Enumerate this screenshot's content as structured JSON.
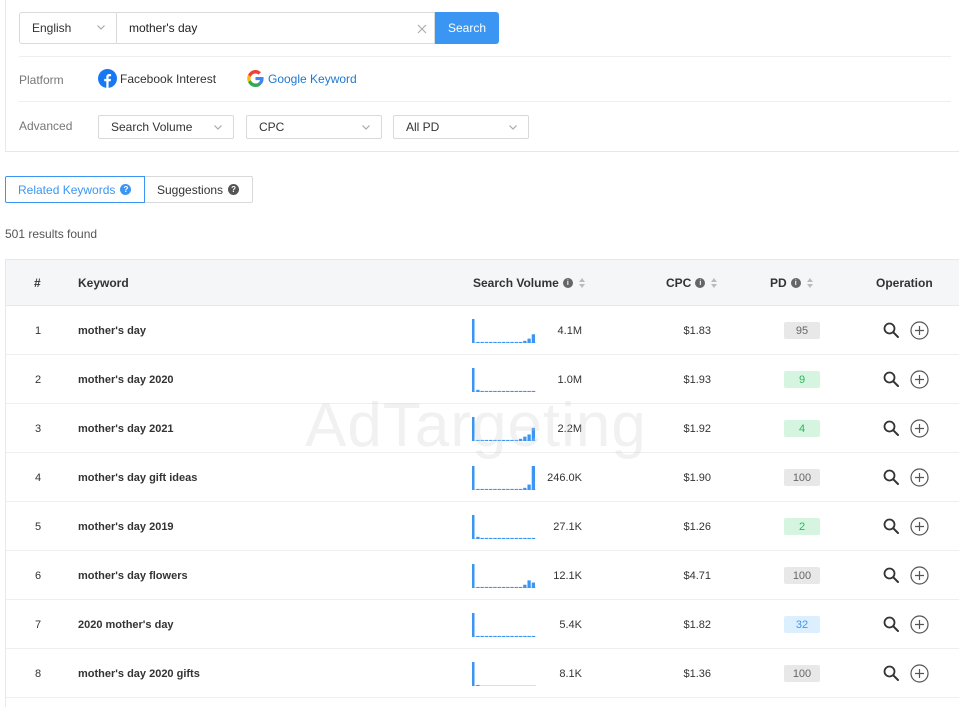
{
  "search": {
    "language": "English",
    "query": "mother's day",
    "button": "Search"
  },
  "platform": {
    "label": "Platform",
    "facebook": "Facebook Interest",
    "google": "Google Keyword"
  },
  "advanced": {
    "label": "Advanced",
    "filters": [
      "Search Volume",
      "CPC",
      "All PD"
    ]
  },
  "tabs": {
    "related": "Related Keywords",
    "suggestions": "Suggestions"
  },
  "results_text": "501 results found",
  "table": {
    "headers": {
      "num": "#",
      "keyword": "Keyword",
      "volume": "Search Volume",
      "cpc": "CPC",
      "pd": "PD",
      "operation": "Operation"
    },
    "rows": [
      {
        "num": "1",
        "keyword": "mother's day",
        "volume": "4.1M",
        "cpc": "$1.83",
        "pd": "95",
        "pd_level": "gray",
        "spark": [
          22,
          1,
          1,
          1,
          1,
          1,
          1,
          1,
          1,
          1,
          1,
          1,
          2,
          4,
          8
        ]
      },
      {
        "num": "2",
        "keyword": "mother's day 2020",
        "volume": "1.0M",
        "cpc": "$1.93",
        "pd": "9",
        "pd_level": "green",
        "spark": [
          22,
          2,
          1,
          1,
          1,
          1,
          1,
          1,
          1,
          1,
          1,
          1,
          1,
          1,
          1
        ]
      },
      {
        "num": "3",
        "keyword": "mother's day 2021",
        "volume": "2.2M",
        "cpc": "$1.92",
        "pd": "4",
        "pd_level": "green",
        "spark": [
          22,
          1,
          1,
          1,
          1,
          1,
          1,
          1,
          1,
          1,
          1,
          2,
          4,
          6,
          12
        ]
      },
      {
        "num": "4",
        "keyword": "mother's day gift ideas",
        "volume": "246.0K",
        "cpc": "$1.90",
        "pd": "100",
        "pd_level": "gray",
        "spark": [
          22,
          1,
          1,
          1,
          1,
          1,
          1,
          1,
          1,
          1,
          1,
          1,
          2,
          5,
          22
        ]
      },
      {
        "num": "5",
        "keyword": "mother's day 2019",
        "volume": "27.1K",
        "cpc": "$1.26",
        "pd": "2",
        "pd_level": "green",
        "spark": [
          22,
          2,
          1,
          1,
          1,
          1,
          1,
          1,
          1,
          1,
          1,
          1,
          1,
          1,
          1
        ]
      },
      {
        "num": "6",
        "keyword": "mother's day flowers",
        "volume": "12.1K",
        "cpc": "$4.71",
        "pd": "100",
        "pd_level": "gray",
        "spark": [
          22,
          1,
          1,
          1,
          1,
          1,
          1,
          1,
          1,
          1,
          1,
          1,
          3,
          7,
          5
        ]
      },
      {
        "num": "7",
        "keyword": "2020 mother's day",
        "volume": "5.4K",
        "cpc": "$1.82",
        "pd": "32",
        "pd_level": "blue",
        "spark": [
          22,
          1,
          1,
          1,
          1,
          1,
          1,
          1,
          1,
          1,
          1,
          1,
          1,
          1,
          1
        ]
      },
      {
        "num": "8",
        "keyword": "mother's day 2020 gifts",
        "volume": "8.1K",
        "cpc": "$1.36",
        "pd": "100",
        "pd_level": "gray",
        "spark": [
          22,
          1,
          0,
          0,
          0,
          0,
          0,
          0,
          0,
          0,
          0,
          0,
          0,
          0,
          0
        ]
      }
    ]
  },
  "watermark": "AdTargeting",
  "colors": {
    "accent": "#3b96f3",
    "spark": "#3b96f3",
    "pd_gray_bg": "#e8e8e8",
    "pd_gray_fg": "#666666",
    "pd_green_bg": "#d6f5e1",
    "pd_green_fg": "#2fb45a",
    "pd_blue_bg": "#dbefff",
    "pd_blue_fg": "#3b96f3"
  },
  "icons": {
    "language_chevron": "chevron-down-icon",
    "clear": "close-icon",
    "facebook": "facebook-icon",
    "google": "google-icon",
    "info": "info-icon",
    "sort": "sort-icon",
    "search": "search-icon",
    "add": "add-circle-icon"
  }
}
